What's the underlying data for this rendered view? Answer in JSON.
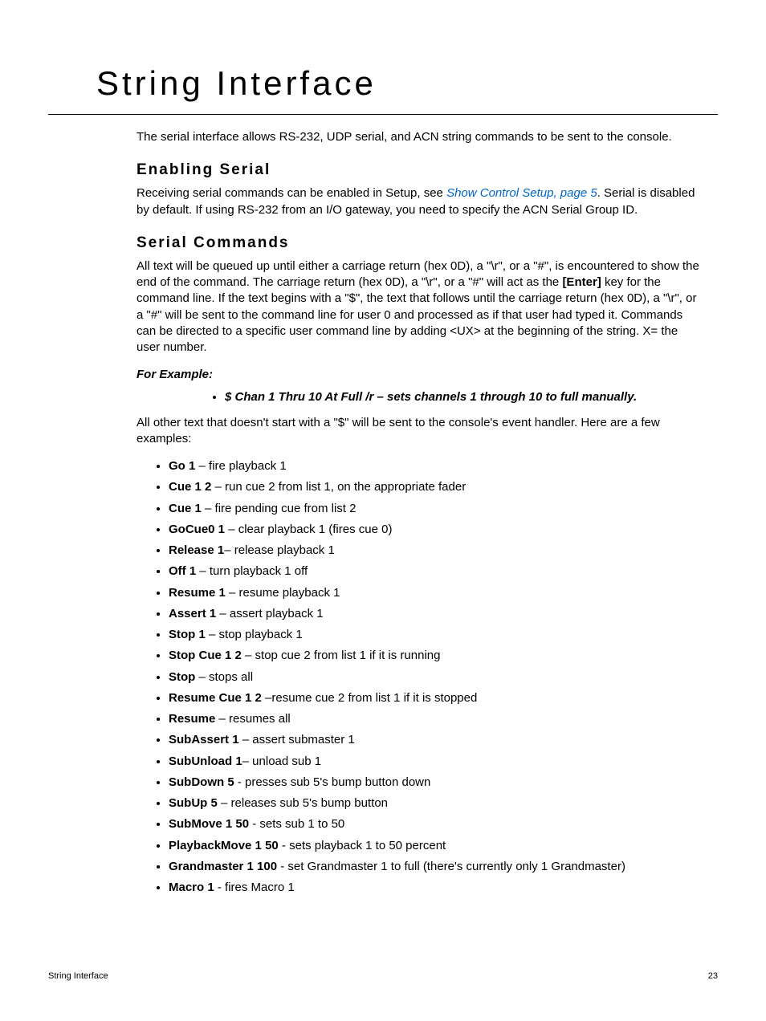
{
  "title": "String Interface",
  "intro": "The serial interface allows RS-232, UDP serial, and ACN string commands to be sent to the console.",
  "section1": {
    "heading": "Enabling Serial",
    "text_before_link": "Receiving serial commands can be enabled in Setup, see ",
    "link": "Show Control Setup, page 5",
    "text_after_link": ". Serial is disabled by default. If using RS-232 from an I/O gateway, you need to specify the ACN Serial Group ID."
  },
  "section2": {
    "heading": "Serial Commands",
    "para1_a": "All text will be queued up until either a carriage return (hex 0D), a \"\\r\", or a \"#\", is encountered to show the end of the command. The carriage return (hex 0D), a \"\\r\", or a \"#\" will act as the ",
    "para1_bold": "[Enter]",
    "para1_b": " key for the command line. If the text begins with a \"$\", the text that follows until the carriage return (hex 0D), a \"\\r\", or a \"#\" will be sent to the command line for user 0 and processed as if that user had typed it. Commands can be directed to a specific user command line by adding <UX> at the beginning of the string. X= the user number.",
    "for_example": "For Example:",
    "example_item": "$ Chan 1 Thru 10 At Full /r – sets channels 1 through 10 to full manually.",
    "para2": "All other text that doesn't start with a \"$\" will be sent to the console's event handler. Here are a few examples:",
    "commands": [
      {
        "cmd": "Go 1",
        "sep": " – ",
        "desc": "fire playback 1"
      },
      {
        "cmd": "Cue 1 2",
        "sep": " – ",
        "desc": "run cue 2 from list 1, on the appropriate fader"
      },
      {
        "cmd": "Cue 1",
        "sep": " – ",
        "desc": "fire pending cue from list 2"
      },
      {
        "cmd": "GoCue0 1",
        "sep": " – ",
        "desc": "clear playback 1 (fires cue 0)"
      },
      {
        "cmd": "Release 1",
        "sep": "– ",
        "desc": "release playback 1"
      },
      {
        "cmd": "Off 1",
        "sep": " – ",
        "desc": "turn playback 1 off"
      },
      {
        "cmd": "Resume 1",
        "sep": " – ",
        "desc": "resume playback 1"
      },
      {
        "cmd": "Assert 1",
        "sep": " – ",
        "desc": "assert playback 1"
      },
      {
        "cmd": "Stop 1",
        "sep": " – ",
        "desc": "stop playback 1"
      },
      {
        "cmd": "Stop Cue 1 2",
        "sep": " – ",
        "desc": "stop cue 2 from list 1 if it is running"
      },
      {
        "cmd": "Stop",
        "sep": " – ",
        "desc": "stops all"
      },
      {
        "cmd": "Resume Cue 1 2",
        "sep": " –",
        "desc": "resume cue 2 from list 1 if it is stopped"
      },
      {
        "cmd": "Resume",
        "sep": " – ",
        "desc": "resumes all"
      },
      {
        "cmd": "SubAssert 1",
        "sep": " – ",
        "desc": "assert submaster 1"
      },
      {
        "cmd": "SubUnload 1",
        "sep": "– ",
        "desc": "unload sub 1"
      },
      {
        "cmd": "SubDown 5",
        "sep": " - ",
        "desc": "presses sub 5's bump button down"
      },
      {
        "cmd": "SubUp 5",
        "sep": " – ",
        "desc": "releases sub 5's bump button"
      },
      {
        "cmd": "SubMove 1 50",
        "sep": " - ",
        "desc": "sets sub 1 to 50"
      },
      {
        "cmd": "PlaybackMove 1 50",
        "sep": " - ",
        "desc": "sets playback 1 to 50 percent"
      },
      {
        "cmd": "Grandmaster 1 100",
        "sep": " - ",
        "desc": "set Grandmaster 1 to full (there's currently only 1 Grandmaster)"
      },
      {
        "cmd": "Macro 1",
        "sep": " - ",
        "desc": "fires Macro 1"
      }
    ]
  },
  "footer": {
    "left": "String Interface",
    "right": "23"
  }
}
